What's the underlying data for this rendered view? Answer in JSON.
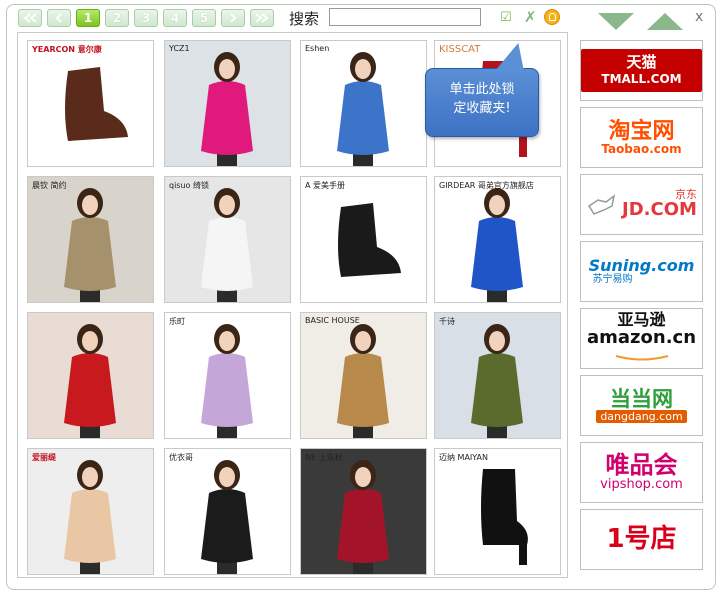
{
  "pager": {
    "first_icon": "double-left-arrow-icon",
    "prev_icon": "left-arrow-icon",
    "pages": [
      "1",
      "2",
      "3",
      "4",
      "5"
    ],
    "active_page": "1",
    "next_icon": "right-arrow-icon",
    "last_icon": "double-right-arrow-icon"
  },
  "search": {
    "label": "搜索",
    "value": ""
  },
  "toolbar": {
    "confirm_icon": "check-icon",
    "delete_icon": "x-icon",
    "lock_icon": "lock-icon"
  },
  "tooltip": {
    "line1": "单击此处锁",
    "line2": "定收藏夹!"
  },
  "nav": {
    "down_icon": "down-triangle-icon",
    "up_icon": "up-triangle-icon",
    "close_label": "x"
  },
  "colors": {
    "accent_green": "#7cc320",
    "border_green": "#b9c9b9",
    "tooltip_blue": "#4a7fcc",
    "tmall_red": "#c40000",
    "taobao_orange": "#ff5000",
    "jd_red": "#e4393c",
    "suning_blue": "#0079c8",
    "dangdang_green": "#2e9f3a",
    "vip_pink": "#d1006f"
  },
  "products": [
    {
      "brand": "YEARCON 意尔康",
      "style": "red",
      "kind": "boot-brown"
    },
    {
      "brand": "YCZ1",
      "style": "plain",
      "kind": "woman-pink"
    },
    {
      "brand": "Eshen",
      "style": "plain",
      "kind": "woman-floral"
    },
    {
      "brand": "KISSCAT",
      "style": "orange",
      "kind": "boot-red"
    },
    {
      "brand": "晨钦 简约",
      "style": "plain",
      "kind": "woman-trench"
    },
    {
      "brand": "qisuo 绮锁",
      "style": "plain",
      "kind": "woman-white"
    },
    {
      "brand": "A 爱美手册",
      "style": "plain",
      "kind": "boot-black"
    },
    {
      "brand": "GIRDEAR 哥弟官方旗舰店",
      "style": "plain",
      "kind": "woman-blue"
    },
    {
      "brand": "",
      "style": "plain",
      "kind": "woman-red"
    },
    {
      "brand": "乐町",
      "style": "plain",
      "kind": "woman-lilac"
    },
    {
      "brand": "BASIC HOUSE",
      "style": "plain",
      "kind": "woman-tan"
    },
    {
      "brand": "千诗",
      "style": "plain",
      "kind": "woman-green"
    },
    {
      "brand": "爱丽缇",
      "style": "red",
      "kind": "woman-lace"
    },
    {
      "brand": "优衣哥",
      "style": "plain",
      "kind": "woman-blackjacket"
    },
    {
      "brand": "NE 上东秋",
      "style": "plain",
      "kind": "woman-crimson"
    },
    {
      "brand": "迈纳 MAIYAN",
      "style": "plain",
      "kind": "boot-blackhigh"
    }
  ],
  "sites": [
    {
      "name": "tmall",
      "line1": "天猫",
      "line2": "TMALL.COM"
    },
    {
      "name": "taobao",
      "line1": "淘宝网",
      "line2": "Taobao.com"
    },
    {
      "name": "jd",
      "line1": "京东",
      "line2": "JD.COM"
    },
    {
      "name": "suning",
      "line1": "Suning.com",
      "line2": "苏宁易购"
    },
    {
      "name": "amazon",
      "line1": "亚马逊",
      "line2": "amazon.cn"
    },
    {
      "name": "dangdang",
      "line1": "当当网",
      "line2": "dangdang.com"
    },
    {
      "name": "vipshop",
      "line1": "唯品会",
      "line2": "vipshop.com"
    },
    {
      "name": "yhd",
      "line1": "1号店",
      "line2": ""
    }
  ]
}
